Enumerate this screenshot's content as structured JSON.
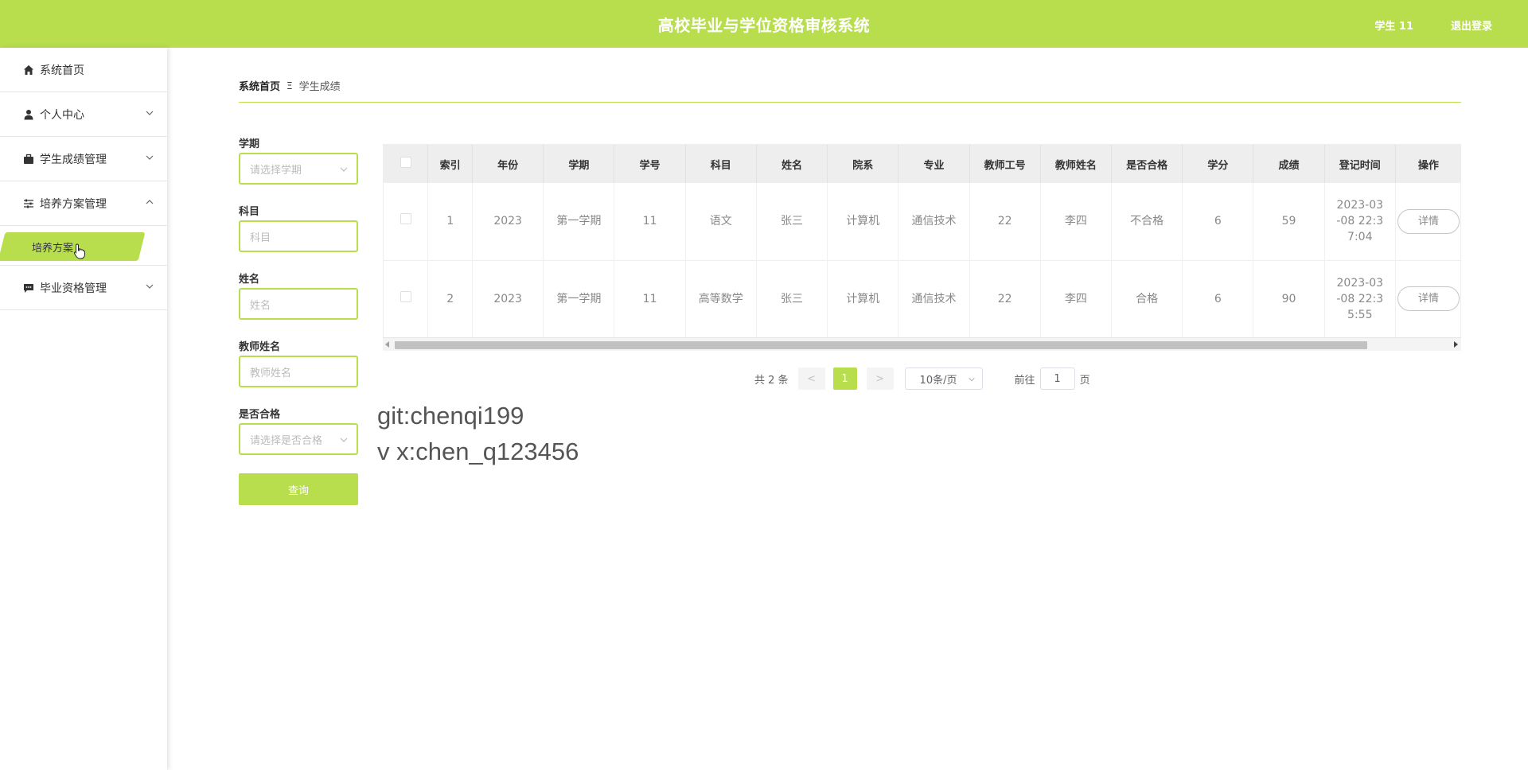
{
  "header": {
    "title": "高校毕业与学位资格审核系统",
    "user": "学生 11",
    "logout": "退出登录"
  },
  "sidebar": {
    "items": [
      {
        "label": "系统首页",
        "icon": "home-icon"
      },
      {
        "label": "个人中心",
        "icon": "user-icon"
      },
      {
        "label": "学生成绩管理",
        "icon": "briefcase-icon"
      },
      {
        "label": "培养方案管理",
        "icon": "sliders-icon"
      },
      {
        "label": "毕业资格管理",
        "icon": "chat-icon"
      }
    ],
    "active_sub": "培养方案"
  },
  "breadcrumb": {
    "home": "系统首页",
    "sep": "Ξ",
    "current": "学生成绩"
  },
  "filters": {
    "term": {
      "label": "学期",
      "placeholder": "请选择学期"
    },
    "subject": {
      "label": "科目",
      "placeholder": "科目"
    },
    "name": {
      "label": "姓名",
      "placeholder": "姓名"
    },
    "teacher": {
      "label": "教师姓名",
      "placeholder": "教师姓名"
    },
    "pass": {
      "label": "是否合格",
      "placeholder": "请选择是否合格"
    },
    "search_label": "查询"
  },
  "table": {
    "headers": [
      "索引",
      "年份",
      "学期",
      "学号",
      "科目",
      "姓名",
      "院系",
      "专业",
      "教师工号",
      "教师姓名",
      "是否合格",
      "学分",
      "成绩",
      "登记时间",
      "操作"
    ],
    "rows": [
      {
        "index": "1",
        "year": "2023",
        "term": "第一学期",
        "sid": "11",
        "subject": "语文",
        "name": "张三",
        "dept": "计算机",
        "major": "通信技术",
        "tid": "22",
        "tname": "李四",
        "pass": "不合格",
        "credit": "6",
        "score": "59",
        "time_l1": "2023-03",
        "time_l2": "-08 22:3",
        "time_l3": "7:04",
        "action": "详情"
      },
      {
        "index": "2",
        "year": "2023",
        "term": "第一学期",
        "sid": "11",
        "subject": "高等数学",
        "name": "张三",
        "dept": "计算机",
        "major": "通信技术",
        "tid": "22",
        "tname": "李四",
        "pass": "合格",
        "credit": "6",
        "score": "90",
        "time_l1": "2023-03",
        "time_l2": "-08 22:3",
        "time_l3": "5:55",
        "action": "详情"
      }
    ]
  },
  "pagination": {
    "total": "共 2 条",
    "prev": "<",
    "current": "1",
    "next": ">",
    "size": "10条/页",
    "goto": "前往",
    "page_value": "1",
    "page_unit": "页"
  },
  "watermark": {
    "line1": "git:chenqi199",
    "line2": "v x:chen_q123456"
  },
  "colors": {
    "accent": "#b8de4e"
  }
}
